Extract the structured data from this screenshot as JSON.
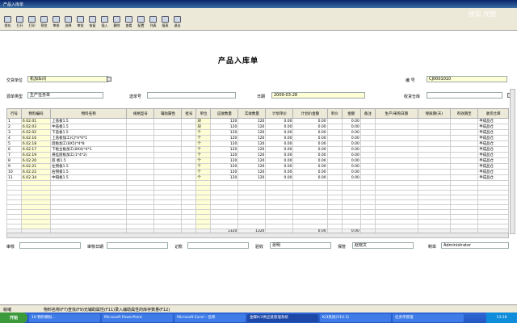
{
  "window": {
    "title": "产品入库单"
  },
  "toolbar": {
    "buttons": [
      "保存",
      "打开",
      "打印",
      "预览",
      "审核",
      "选择",
      "审批",
      "恢复",
      "插入",
      "删除",
      "查看",
      "配置",
      "列表",
      "报表",
      "退出"
    ]
  },
  "form": {
    "title": "产品入库单",
    "dept_label": "交货单位",
    "dept_value": "机加车间",
    "num_label": "编    号",
    "num_value": "CJ0001010",
    "source_label": "源单类型",
    "source_value": "生产任务单",
    "select_label": "选单号",
    "date_label": "日期",
    "date_value": "2009-03-28",
    "warehouse_label": "收货仓库"
  },
  "table": {
    "headers": [
      "行号",
      "物料编码",
      "物料名称",
      "规格型号",
      "辅助属性",
      "批号",
      "单位",
      "应收数量",
      "实收数量",
      "计划单价",
      "计划价金额",
      "单价",
      "金额",
      "备注",
      "生产/采购日期",
      "保质期(天)",
      "有效期至",
      "收货仓库"
    ],
    "rows": [
      [
        "1",
        "6.02.01",
        "上盖板1.5",
        "",
        "",
        "",
        "块",
        "120",
        "120",
        "0.00",
        "0.00",
        "",
        "0.00",
        "",
        "",
        "",
        "",
        "半成品仓"
      ],
      [
        "2",
        "6.02.03",
        "中盖板1.5",
        "",
        "",
        "",
        "块",
        "120",
        "120",
        "0.00",
        "0.00",
        "",
        "0.00",
        "",
        "",
        "",
        "",
        "半成品仓"
      ],
      [
        "3",
        "6.02.02",
        "下盖板1.5",
        "",
        "",
        "",
        "个",
        "120",
        "120",
        "0.00",
        "0.00",
        "",
        "0.00",
        "",
        "",
        "",
        "",
        "半成品仓"
      ],
      [
        "4",
        "6.02.16",
        "上盖板加工(CJ*4*0*1",
        "",
        "",
        "",
        "个",
        "120",
        "120",
        "0.00",
        "0.00",
        "",
        "0.00",
        "",
        "",
        "",
        "",
        "半成品仓"
      ],
      [
        "5",
        "6.02.18",
        "后板加工(8X5)*4*8",
        "",
        "",
        "",
        "个",
        "120",
        "120",
        "0.00",
        "0.00",
        "",
        "0.00",
        "",
        "",
        "",
        "",
        "半成品仓"
      ],
      [
        "6",
        "6.02.17",
        "下板主板加工(8X4)*4*1",
        "",
        "",
        "",
        "个",
        "120",
        "120",
        "0.00",
        "0.00",
        "",
        "0.00",
        "",
        "",
        "",
        "",
        "半成品仓"
      ],
      [
        "7",
        "6.02.19",
        "悬挂座板加工(1*4*2)",
        "",
        "",
        "",
        "个",
        "120",
        "120",
        "0.00",
        "0.00",
        "",
        "0.00",
        "",
        "",
        "",
        "",
        "半成品仓"
      ],
      [
        "8",
        "6.02.20",
        "底    板1.5",
        "",
        "",
        "",
        "个",
        "120",
        "120",
        "0.00",
        "0.00",
        "",
        "0.00",
        "",
        "",
        "",
        "",
        "半成品仓"
      ],
      [
        "9",
        "6.02.21",
        "左侧板1.5",
        "",
        "",
        "",
        "个",
        "120",
        "120",
        "0.00",
        "0.00",
        "",
        "0.00",
        "",
        "",
        "",
        "",
        "半成品仓"
      ],
      [
        "10",
        "6.02.22",
        "右侧板1.5",
        "",
        "",
        "",
        "个",
        "120",
        "120",
        "0.00",
        "0.00",
        "",
        "0.00",
        "",
        "",
        "",
        "",
        "半成品仓"
      ],
      [
        "11",
        "6.02.34",
        "中隔板1.5",
        "",
        "",
        "",
        "个",
        "120",
        "120",
        "0.00",
        "0.00",
        "",
        "0.00",
        "",
        "",
        "",
        "",
        "半成品仓"
      ]
    ],
    "total": {
      "qty1": "1320",
      "qty2": "1320",
      "amt1": "0.00",
      "amt2": "0.00"
    }
  },
  "footer": {
    "review_label": "审核",
    "review_date_label": "审核日期",
    "account_label": "记账",
    "verify_label": "验收",
    "verify_value": "张明",
    "keeper_label": "保管",
    "keeper_value": "赵晓文",
    "maker_label": "制单",
    "maker_value": "Administrator"
  },
  "status": {
    "left": "就绪",
    "middle": "物料名称(F7)查找(F9)无辅助属性(F11)录入辅助属性的库存数量(F12)"
  },
  "taskbar": {
    "start": "开始",
    "tasks": [
      "10-物料模拟...",
      "Microsoft PowerPoint",
      "Microsoft Excel - 名称",
      "金蝶K/3供应链管理系统",
      "K/3系统(V10.3)",
      "任务单管理"
    ],
    "tray": "13:28"
  },
  "watermark": "搜狐 优酷"
}
